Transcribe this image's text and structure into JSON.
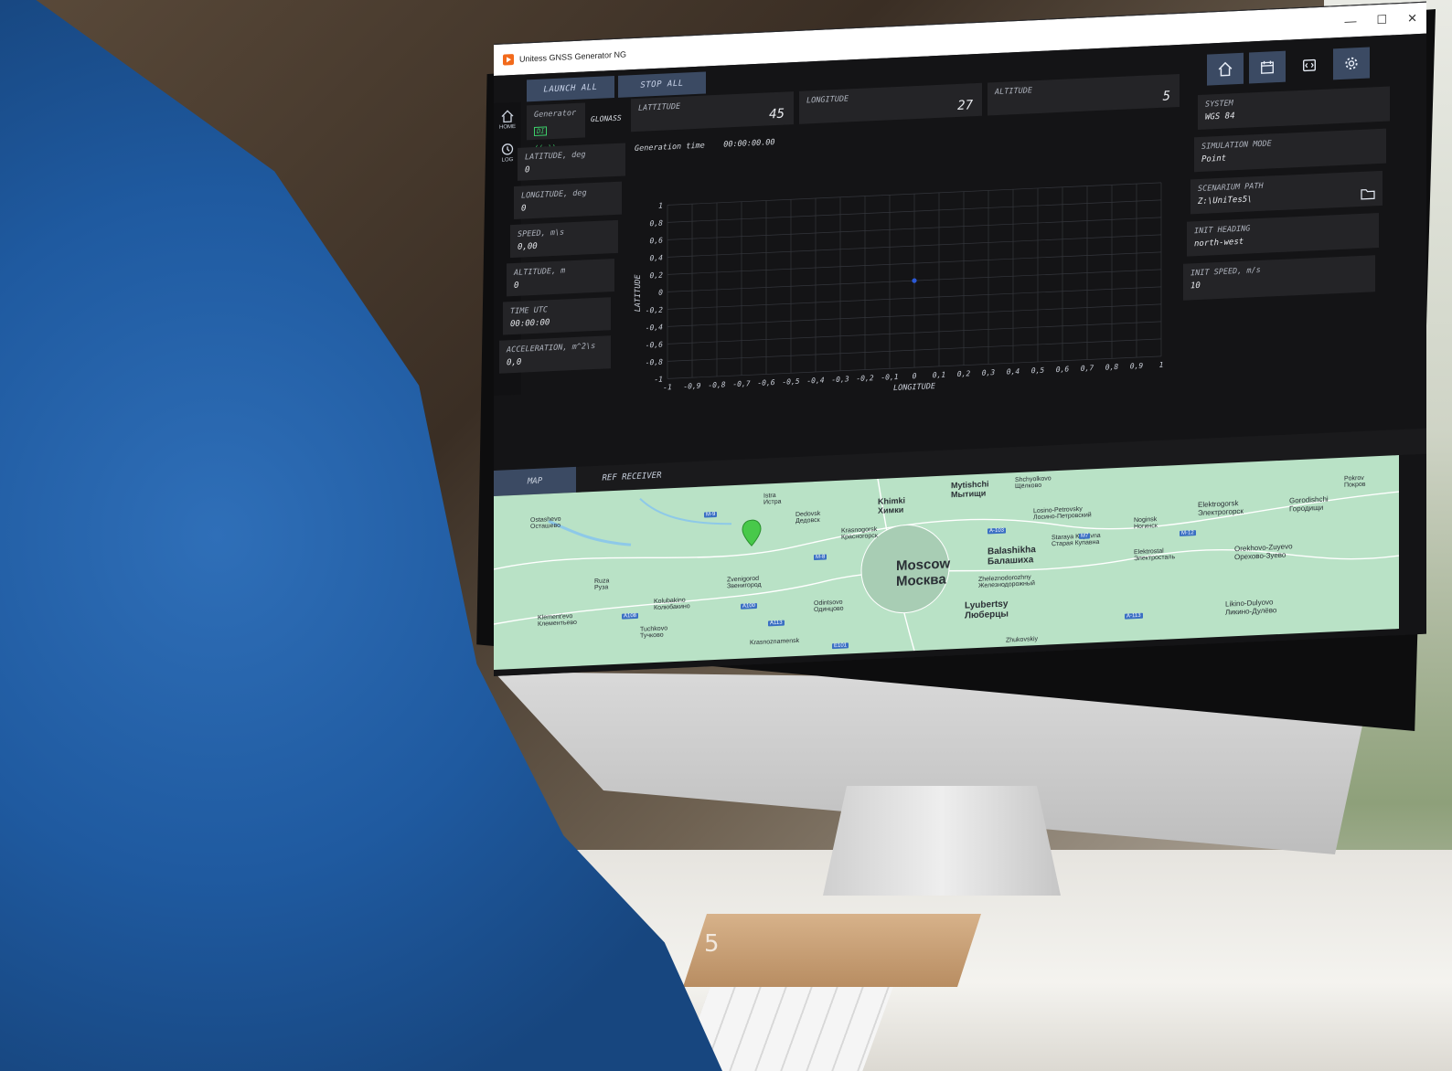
{
  "window": {
    "title": "Unitess GNSS Generator NG",
    "controls": [
      "—",
      "☐",
      "✕"
    ]
  },
  "nav": [
    {
      "icon": "home-icon",
      "label": "HOME"
    },
    {
      "icon": "log-icon",
      "label": "LOG"
    }
  ],
  "toolbar": {
    "launch_all": "LAUNCH ALL",
    "stop_all": "STOP ALL"
  },
  "generator": {
    "label": "Generator",
    "badge": "DI",
    "system": "GLONASS"
  },
  "coords": {
    "latitude_label": "LATTITUDE",
    "latitude_value": "45",
    "longitude_label": "LONGITUDE",
    "longitude_value": "27",
    "altitude_label": "ALTITUDE",
    "altitude_value": "5"
  },
  "left_panels": [
    {
      "label": "LATITUDE, deg",
      "value": "0"
    },
    {
      "label": "LONGITUDE, deg",
      "value": "0"
    },
    {
      "label": "SPEED, m\\s",
      "value": "0,00"
    },
    {
      "label": "ALTITUDE, m",
      "value": "0"
    },
    {
      "label": "TIME UTC",
      "value": "00:00:00"
    },
    {
      "label": "ACCELERATION, m^2\\s",
      "value": "0,0"
    }
  ],
  "generation_time": {
    "label": "Generation time",
    "value": "00:00:00.00"
  },
  "right_panels": [
    {
      "label": "SYSTEM",
      "value": "WGS 84"
    },
    {
      "label": "SIMULATION MODE",
      "value": "Point"
    },
    {
      "label": "SCENARIUM PATH",
      "value": "Z:\\UniTes5\\"
    },
    {
      "label": "INIT HEADING",
      "value": "north-west"
    },
    {
      "label": "INIT SPEED, m/s",
      "value": "10"
    }
  ],
  "right_icons": [
    "home-icon",
    "calendar-icon",
    "code-icon",
    "gear-icon"
  ],
  "tabs": {
    "map": "MAP",
    "ref_receiver": "REF RECEIVER"
  },
  "chart_data": {
    "type": "scatter",
    "xlabel": "LONGITUDE",
    "ylabel": "LATITUDE",
    "xlim": [
      -1,
      1
    ],
    "ylim": [
      -1,
      1
    ],
    "x_ticks": [
      "-1",
      "-0,9",
      "-0,8",
      "-0,7",
      "-0,6",
      "-0,5",
      "-0,4",
      "-0,3",
      "-0,2",
      "-0,1",
      "0",
      "0,1",
      "0,2",
      "0,3",
      "0,4",
      "0,5",
      "0,6",
      "0,7",
      "0,8",
      "0,9",
      "1"
    ],
    "y_ticks": [
      "1",
      "0,8",
      "0,6",
      "0,4",
      "0,2",
      "0",
      "-0,2",
      "-0,4",
      "-0,6",
      "-0,8",
      "-1"
    ],
    "points": [
      {
        "x": 0.0,
        "y": 0.0
      }
    ],
    "grid": true,
    "point_color": "#2b59d6"
  },
  "map": {
    "cities": [
      {
        "en": "Moscow",
        "ru": "Москва"
      },
      {
        "en": "Khimki",
        "ru": "Химки"
      },
      {
        "en": "Balashikha",
        "ru": "Балашиха"
      },
      {
        "en": "Lyubertsy",
        "ru": "Люберцы"
      },
      {
        "en": "Zvenigorod",
        "ru": "Звенигород"
      },
      {
        "en": "Odintsovo",
        "ru": "Одинцово"
      },
      {
        "en": "Dedovsk",
        "ru": "Дедовск"
      },
      {
        "en": "Krasnogorsk",
        "ru": "Красногорск"
      },
      {
        "en": "Istra",
        "ru": "Истра"
      },
      {
        "en": "Ruza",
        "ru": "Руза"
      },
      {
        "en": "Kolubakino",
        "ru": "Колюбакино"
      },
      {
        "en": "Tuchkovo",
        "ru": "Тучково"
      },
      {
        "en": "Ostashevo",
        "ru": "Осташево"
      },
      {
        "en": "Klement'evo",
        "ru": "Клементьево"
      },
      {
        "en": "Noginsk",
        "ru": "Ногинск"
      },
      {
        "en": "Elektrogorsk",
        "ru": "Электрогорск"
      },
      {
        "en": "Orekhovo-Zuyevo",
        "ru": "Орехово-Зуево"
      },
      {
        "en": "Likino-Dulyovo",
        "ru": "Ликино-Дулёво"
      },
      {
        "en": "Zhukovskiy",
        "ru": ""
      },
      {
        "en": "Elektrostal",
        "ru": "Электросталь"
      },
      {
        "en": "Staraya Kupavna",
        "ru": "Старая Купавна"
      },
      {
        "en": "Zheleznodorozhny",
        "ru": "Железнодорожный"
      },
      {
        "en": "Shchyolkovo",
        "ru": "Щёлково"
      },
      {
        "en": "Losino-Petrovsky",
        "ru": "Лосино-Петровский"
      },
      {
        "en": "Mytishchi",
        "ru": "Мытищи"
      },
      {
        "en": "Krasnoznamensk",
        "ru": ""
      },
      {
        "en": "Pokrov",
        "ru": "Покров"
      },
      {
        "en": "Gorodishchi",
        "ru": "Городищи"
      }
    ],
    "roads": [
      "M-9",
      "A-103",
      "M7",
      "M-12",
      "A108",
      "A-113",
      "A100",
      "A113",
      "E101",
      "M-8"
    ]
  },
  "watermark": "5",
  "colors": {
    "accent": "#3b4a63",
    "marker": "#48c94a",
    "point": "#2b59d6"
  }
}
